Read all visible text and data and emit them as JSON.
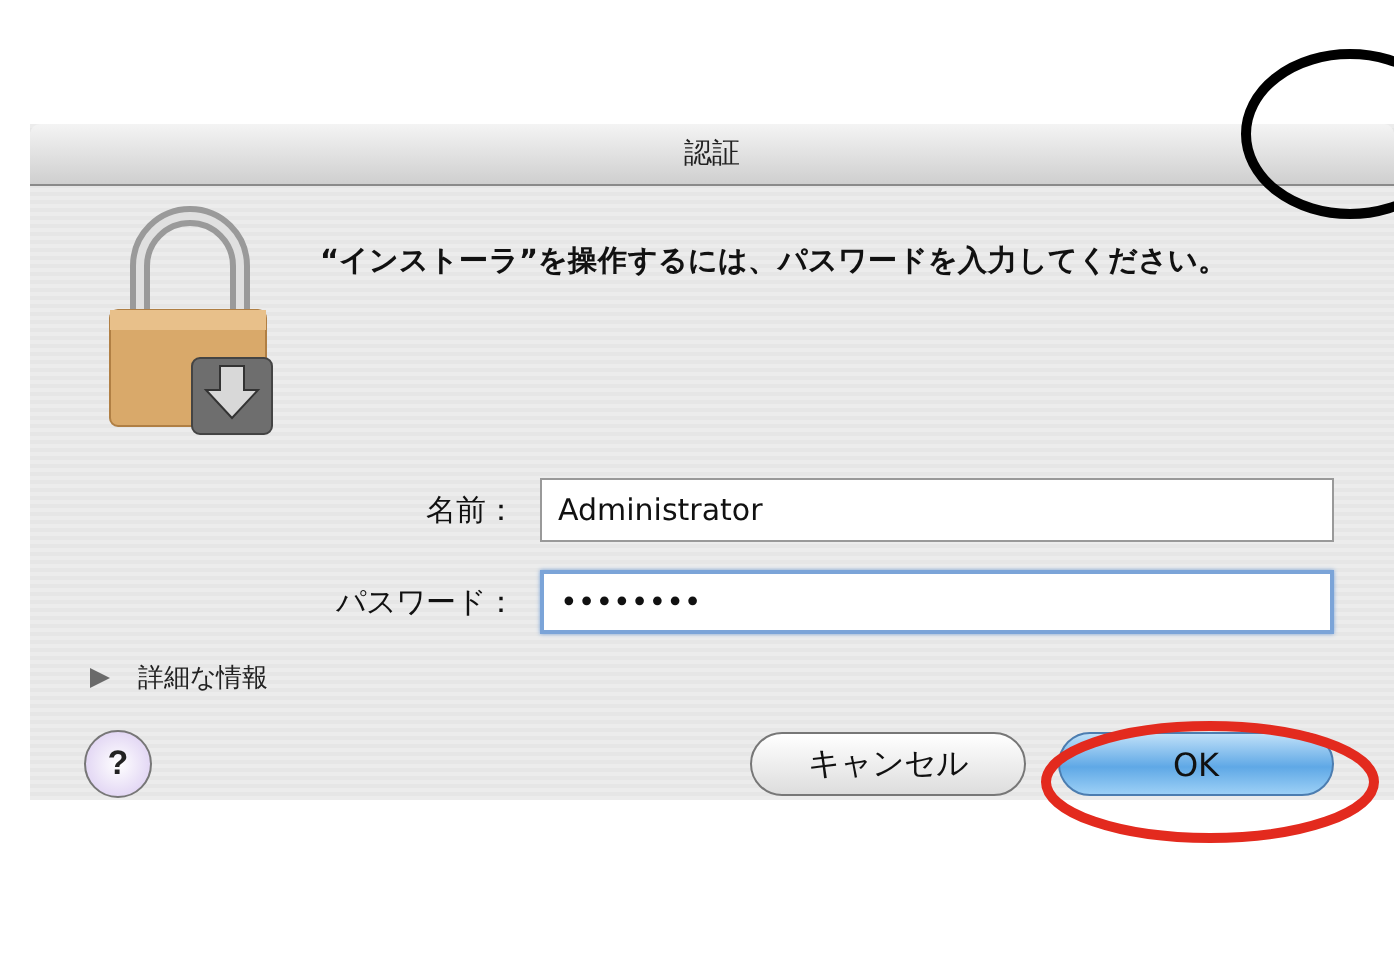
{
  "window": {
    "title": "認証"
  },
  "message": "“インストーラ”を操作するには、パスワードを入力してください。",
  "fields": [
    {
      "label": "名前：",
      "value": "Administrator",
      "focused": false
    },
    {
      "label": "パスワード：",
      "value": "••••••••",
      "focused": true
    }
  ],
  "details": {
    "label": "詳細な情報",
    "expanded": false
  },
  "help": {
    "label": "?"
  },
  "buttons": [
    {
      "label": "キャンセル",
      "default": false
    },
    {
      "label": "OK",
      "default": true
    }
  ]
}
